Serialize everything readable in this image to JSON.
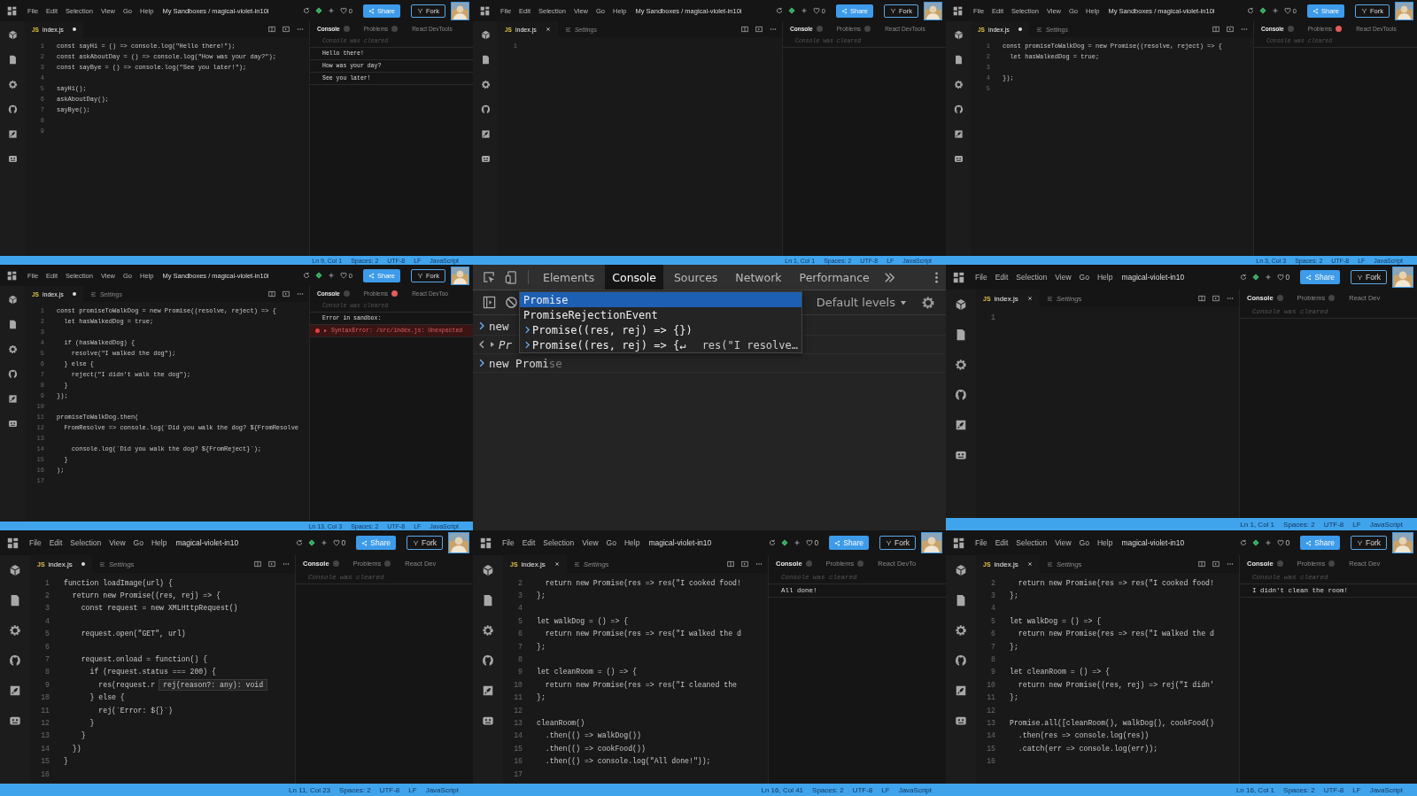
{
  "panels": [
    {
      "kind": "sandbox",
      "topbar": {
        "menus": [
          "File",
          "Edit",
          "Selection",
          "View",
          "Go",
          "Help"
        ],
        "project": "My Sandboxes / magical-violet-in10i",
        "likes": "0",
        "share": "Share",
        "fork": "Fork"
      },
      "editor": {
        "tabs": [
          {
            "kind": "file",
            "type_label": "JS",
            "label": "index.js",
            "modified": true
          }
        ],
        "lines": [
          {
            "n": "1",
            "code": "const sayHi = () => console.log(\"Hello there!\");"
          },
          {
            "n": "2",
            "code": "const askAboutDay = () => console.log(\"How was your day?\");"
          },
          {
            "n": "3",
            "code": "const sayBye = () => console.log(\"See you later!\");"
          },
          {
            "n": "4"
          },
          {
            "n": "5",
            "code": "sayHi();"
          },
          {
            "n": "6",
            "code": "askAboutDay();"
          },
          {
            "n": "7",
            "code": "sayBye();"
          },
          {
            "n": "8"
          },
          {
            "n": "9"
          }
        ]
      },
      "console": {
        "tabs": [
          "Console",
          "Problems",
          "React DevTools"
        ],
        "problems_error": false,
        "lines": [
          {
            "kind": "info",
            "text": "Console was cleared"
          },
          {
            "kind": "log",
            "text": "Hello there!"
          },
          {
            "kind": "log",
            "text": "How was your day?"
          },
          {
            "kind": "log",
            "text": "See you later!"
          }
        ]
      },
      "status": [
        "Ln 9, Col 1",
        "Spaces: 2",
        "UTF-8",
        "LF",
        "JavaScript"
      ]
    },
    {
      "kind": "sandbox",
      "topbar": {
        "menus": [
          "File",
          "Edit",
          "Selection",
          "View",
          "Go",
          "Help"
        ],
        "project": "My Sandboxes / magical-violet-in10i",
        "likes": "0",
        "share": "Share",
        "fork": "Fork"
      },
      "editor": {
        "tabs": [
          {
            "kind": "file",
            "type_label": "JS",
            "label": "index.js",
            "modified": false
          },
          {
            "kind": "settings",
            "label": "Settings"
          }
        ],
        "lines": [
          {
            "n": "1"
          }
        ]
      },
      "console": {
        "tabs": [
          "Console",
          "Problems",
          "React DevTools"
        ],
        "problems_error": false,
        "lines": [
          {
            "kind": "info",
            "text": "Console was cleared"
          }
        ]
      },
      "status": [
        "Ln 1, Col 1",
        "Spaces: 2",
        "UTF-8",
        "LF",
        "JavaScript"
      ]
    },
    {
      "kind": "sandbox",
      "topbar": {
        "menus": [
          "File",
          "Edit",
          "Selection",
          "View",
          "Go",
          "Help"
        ],
        "project": "My Sandboxes / magical-violet-in10i",
        "likes": "0",
        "share": "Share",
        "fork": "Fork"
      },
      "editor": {
        "tabs": [
          {
            "kind": "file",
            "type_label": "JS",
            "label": "index.js",
            "modified": true
          },
          {
            "kind": "settings",
            "label": "Settings"
          }
        ],
        "lines": [
          {
            "n": "1",
            "code": "const promiseToWalkDog = new Promise((resolve, reject) => {"
          },
          {
            "n": "2",
            "code": "  let hasWalkedDog = true;"
          },
          {
            "n": "3"
          },
          {
            "n": "4",
            "code": "});"
          },
          {
            "n": "5"
          }
        ]
      },
      "console": {
        "tabs": [
          "Console",
          "Problems",
          "React DevTools"
        ],
        "problems_error": true,
        "lines": [
          {
            "kind": "info",
            "text": "Console was cleared"
          }
        ]
      },
      "status": [
        "Ln 3, Col 3",
        "Spaces: 2",
        "UTF-8",
        "LF",
        "JavaScript"
      ]
    },
    {
      "kind": "sandbox",
      "topbar": {
        "menus": [
          "File",
          "Edit",
          "Selection",
          "View",
          "Go",
          "Help"
        ],
        "project": "My Sandboxes / magical-violet-in10i",
        "likes": "0",
        "share": "Share",
        "fork": "Fork"
      },
      "editor": {
        "tabs": [
          {
            "kind": "file",
            "type_label": "JS",
            "label": "index.js",
            "modified": true
          },
          {
            "kind": "settings",
            "label": "Settings"
          }
        ],
        "lines": [
          {
            "n": "1",
            "code": "const promiseToWalkDog = new Promise((resolve, reject) => {"
          },
          {
            "n": "2",
            "code": "  let hasWalkedDog = true;"
          },
          {
            "n": "3"
          },
          {
            "n": "4",
            "code": "  if (hasWalkedDog) {"
          },
          {
            "n": "5",
            "code": "    resolve(\"I walked the dog\");"
          },
          {
            "n": "6",
            "code": "  } else {"
          },
          {
            "n": "7",
            "code": "    reject(\"I didn't walk the dog\");"
          },
          {
            "n": "8",
            "code": "  }"
          },
          {
            "n": "9",
            "code": "});"
          },
          {
            "n": "10"
          },
          {
            "n": "11",
            "code": "promiseToWalkDog.then("
          },
          {
            "n": "12",
            "code": "  FromResolve => console.log(`Did you walk the dog? ${FromResolve"
          },
          {
            "n": "13"
          },
          {
            "n": "14",
            "code": "    console.log(`Did you walk the dog? ${FromReject}`);"
          },
          {
            "n": "15",
            "code": "  }"
          },
          {
            "n": "16",
            "code": ");"
          },
          {
            "n": "17"
          }
        ]
      },
      "console": {
        "tabs": [
          "Console",
          "Problems",
          "React DevToo"
        ],
        "problems_error": true,
        "lines": [
          {
            "kind": "info",
            "text": "Console was cleared"
          },
          {
            "kind": "log",
            "text": "Error in sandbox:"
          },
          {
            "kind": "error",
            "text": "SyntaxError: /src/index.js: Unexpected"
          }
        ]
      },
      "status": [
        "Ln 13, Col 3",
        "Spaces: 2",
        "UTF-8",
        "LF",
        "JavaScript"
      ]
    },
    {
      "kind": "devtools",
      "tabs": [
        {
          "label": "Elements",
          "selected": false
        },
        {
          "label": "Console",
          "selected": true
        },
        {
          "label": "Sources",
          "selected": false
        },
        {
          "label": "Network",
          "selected": false
        },
        {
          "label": "Performance",
          "selected": false
        }
      ],
      "levels": "Default levels",
      "lines": [
        {
          "kind": "input",
          "text": "new"
        },
        {
          "kind": "result",
          "text": "Pr"
        },
        {
          "kind": "input",
          "text": "new Promi",
          "ghost": "se"
        }
      ],
      "suggestions": [
        {
          "kind": "name",
          "text": "Promise",
          "selected": true
        },
        {
          "kind": "name",
          "text": "PromiseRejectionEvent",
          "selected": false
        },
        {
          "kind": "snippet",
          "text": "Promise((res, rej) => {})",
          "selected": false
        },
        {
          "kind": "snippet",
          "text": "Promise((res, rej) => {↵",
          "detail": "res(\"I resolve…",
          "selected": false
        }
      ]
    },
    {
      "kind": "sandbox",
      "topbar": {
        "menus": [
          "File",
          "Edit",
          "Selection",
          "View",
          "Go",
          "Help"
        ],
        "project": "magical-violet-in10",
        "likes": "0",
        "share": "Share",
        "fork": "Fork"
      },
      "editor": {
        "tabs": [
          {
            "kind": "file",
            "type_label": "JS",
            "label": "index.js",
            "modified": false
          },
          {
            "kind": "settings",
            "label": "Settings"
          }
        ],
        "lines": [
          {
            "n": "1"
          }
        ]
      },
      "console": {
        "tabs": [
          "Console",
          "Problems",
          "React Dev"
        ],
        "problems_error": false,
        "lines": [
          {
            "kind": "info",
            "text": "Console was cleared"
          }
        ]
      },
      "status": [
        "Ln 1, Col 1",
        "Spaces: 2",
        "UTF-8",
        "LF",
        "JavaScript"
      ]
    },
    {
      "kind": "sandbox",
      "topbar": {
        "menus": [
          "File",
          "Edit",
          "Selection",
          "View",
          "Go",
          "Help"
        ],
        "project": "magical-violet-in10",
        "likes": "0",
        "share": "Share",
        "fork": "Fork"
      },
      "editor": {
        "tabs": [
          {
            "kind": "file",
            "type_label": "JS",
            "label": "index.js",
            "modified": true
          },
          {
            "kind": "settings",
            "label": "Settings"
          }
        ],
        "lines": [
          {
            "n": "1",
            "code": "function loadImage(url) {"
          },
          {
            "n": "2",
            "code": "  return new Promise((res, rej) => {"
          },
          {
            "n": "3",
            "code": "    const request = new XMLHttpRequest()"
          },
          {
            "n": "4"
          },
          {
            "n": "5",
            "code": "    request.open(\"GET\", url)"
          },
          {
            "n": "6"
          },
          {
            "n": "7",
            "code": "    request.onload = function() {"
          },
          {
            "n": "8",
            "code": "      if (request.status === 200) {"
          },
          {
            "n": "9",
            "code": "        res(request.r",
            "hint": "rej(reason?: any): void"
          },
          {
            "n": "10",
            "code": "      } else {"
          },
          {
            "n": "11",
            "code": "        rej(`Error: ${}`)"
          },
          {
            "n": "12",
            "code": "      }"
          },
          {
            "n": "13",
            "code": "    }"
          },
          {
            "n": "14",
            "code": "  })"
          },
          {
            "n": "15",
            "code": "}"
          },
          {
            "n": "16"
          }
        ]
      },
      "console": {
        "tabs": [
          "Console",
          "Problems",
          "React Dev"
        ],
        "problems_error": false,
        "lines": [
          {
            "kind": "info",
            "text": "Console was cleared"
          }
        ]
      },
      "status": [
        "Ln 11, Col 23",
        "Spaces: 2",
        "UTF-8",
        "LF",
        "JavaScript"
      ]
    },
    {
      "kind": "sandbox",
      "topbar": {
        "menus": [
          "File",
          "Edit",
          "Selection",
          "View",
          "Go",
          "Help"
        ],
        "project": "magical-violet-in10",
        "likes": "0",
        "share": "Share",
        "fork": "Fork"
      },
      "editor": {
        "tabs": [
          {
            "kind": "file",
            "type_label": "JS",
            "label": "index.js",
            "modified": false
          },
          {
            "kind": "settings",
            "label": "Settings"
          }
        ],
        "lines": [
          {
            "n": "2",
            "code": "  return new Promise(res => res(\"I cooked food!"
          },
          {
            "n": "3",
            "code": "};"
          },
          {
            "n": "4"
          },
          {
            "n": "5",
            "code": "let walkDog = () => {"
          },
          {
            "n": "6",
            "code": "  return new Promise(res => res(\"I walked the d"
          },
          {
            "n": "7",
            "code": "};"
          },
          {
            "n": "8"
          },
          {
            "n": "9",
            "code": "let cleanRoom = () => {"
          },
          {
            "n": "10",
            "code": "  return new Promise(res => res(\"I cleaned the"
          },
          {
            "n": "11",
            "code": "};"
          },
          {
            "n": "12"
          },
          {
            "n": "13",
            "code": "cleanRoom()"
          },
          {
            "n": "14",
            "code": "  .then(() => walkDog())"
          },
          {
            "n": "15",
            "code": "  .then(() => cookFood())"
          },
          {
            "n": "16",
            "code": "  .then(() => console.log(\"All done!\"));"
          },
          {
            "n": "17"
          }
        ]
      },
      "console": {
        "tabs": [
          "Console",
          "Problems",
          "React DevTo"
        ],
        "problems_error": false,
        "lines": [
          {
            "kind": "info",
            "text": "Console was cleared"
          },
          {
            "kind": "log",
            "text": "All done!"
          }
        ]
      },
      "status": [
        "Ln 16, Col 41",
        "Spaces: 2",
        "UTF-8",
        "LF",
        "JavaScript"
      ]
    },
    {
      "kind": "sandbox",
      "topbar": {
        "menus": [
          "File",
          "Edit",
          "Selection",
          "View",
          "Go",
          "Help"
        ],
        "project": "magical-violet-in10",
        "likes": "0",
        "share": "Share",
        "fork": "Fork"
      },
      "editor": {
        "tabs": [
          {
            "kind": "file",
            "type_label": "JS",
            "label": "index.js",
            "modified": false
          },
          {
            "kind": "settings",
            "label": "Settings"
          }
        ],
        "lines": [
          {
            "n": "2",
            "code": "  return new Promise(res => res(\"I cooked food!"
          },
          {
            "n": "3",
            "code": "};"
          },
          {
            "n": "4"
          },
          {
            "n": "5",
            "code": "let walkDog = () => {"
          },
          {
            "n": "6",
            "code": "  return new Promise(res => res(\"I walked the d"
          },
          {
            "n": "7",
            "code": "};"
          },
          {
            "n": "8"
          },
          {
            "n": "9",
            "code": "let cleanRoom = () => {"
          },
          {
            "n": "10",
            "code": "  return new Promise((res, rej) => rej(\"I didn'"
          },
          {
            "n": "11",
            "code": "};"
          },
          {
            "n": "12"
          },
          {
            "n": "13",
            "code": "Promise.all([cleanRoom(), walkDog(), cookFood()"
          },
          {
            "n": "14",
            "code": "  .then(res => console.log(res))"
          },
          {
            "n": "15",
            "code": "  .catch(err => console.log(err));"
          },
          {
            "n": "16"
          }
        ]
      },
      "console": {
        "tabs": [
          "Console",
          "Problems",
          "React Dev"
        ],
        "problems_error": false,
        "lines": [
          {
            "kind": "info",
            "text": "Console was cleared"
          },
          {
            "kind": "log",
            "text": "I didn't clean the room!"
          }
        ]
      },
      "status": [
        "Ln 16, Col 1",
        "Spaces: 2",
        "UTF-8",
        "LF",
        "JavaScript"
      ]
    }
  ]
}
